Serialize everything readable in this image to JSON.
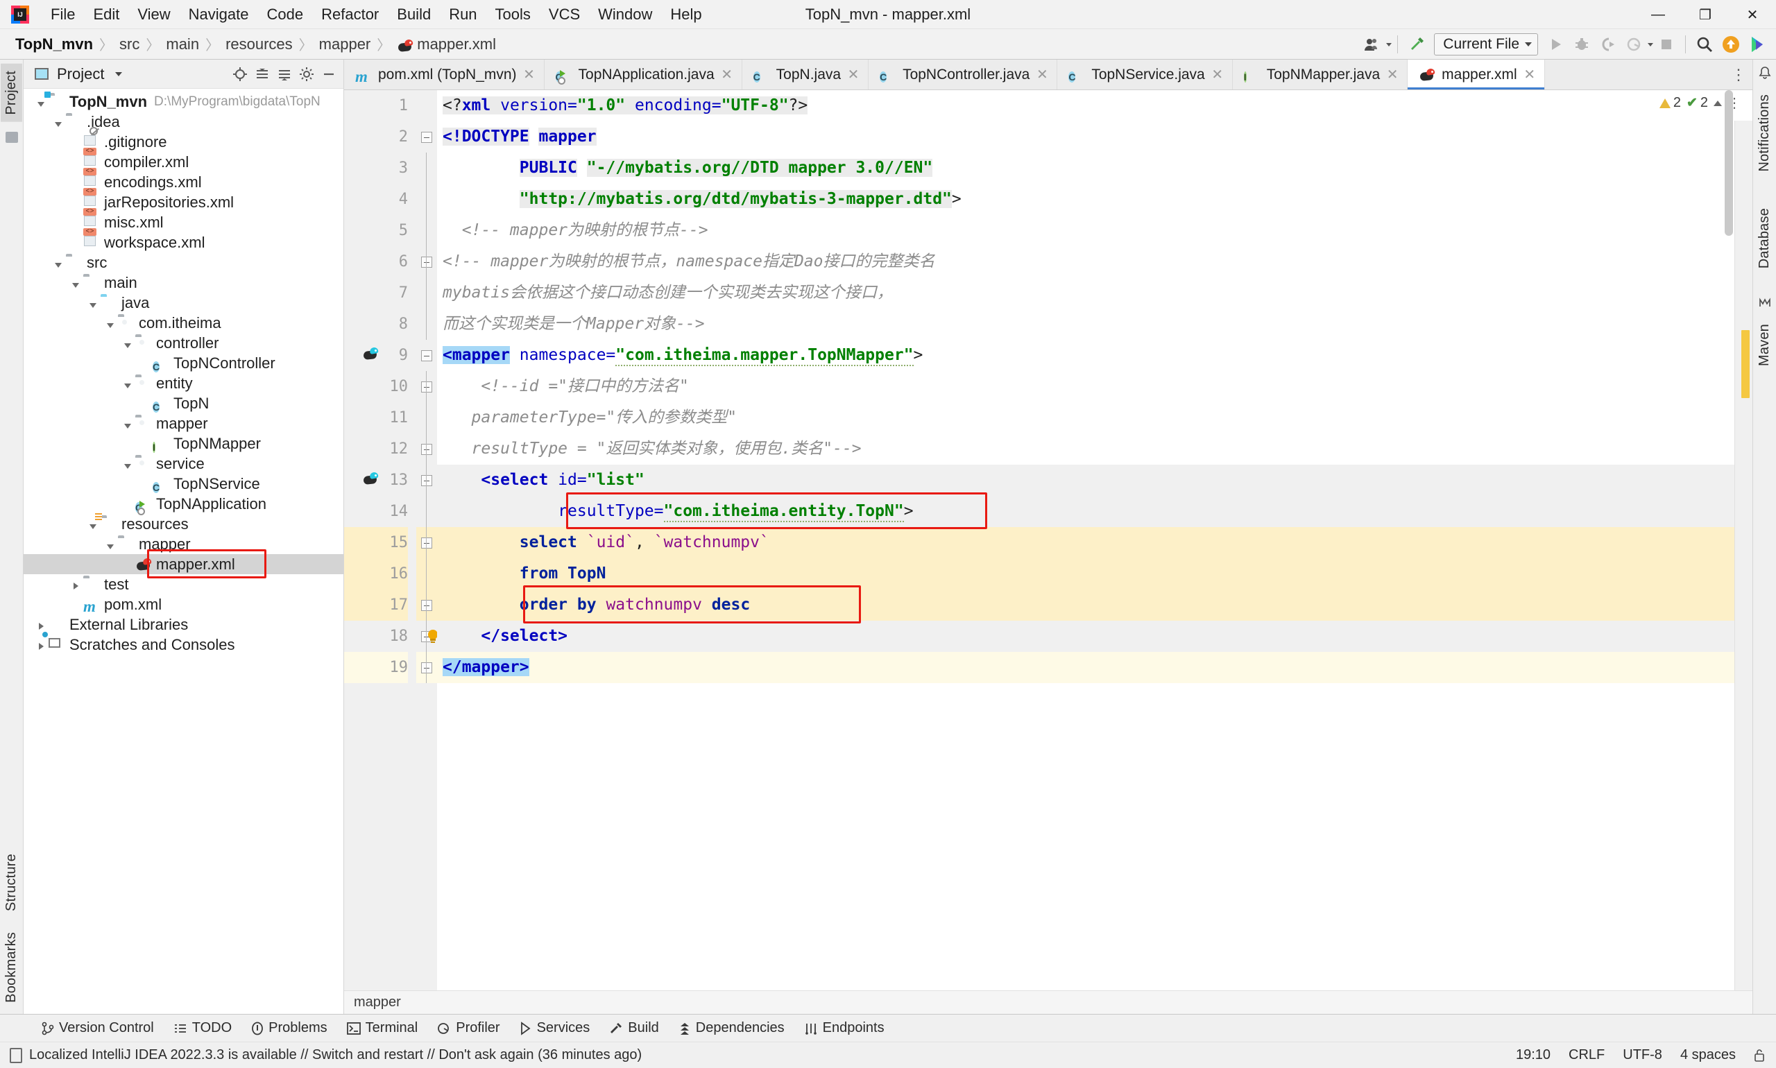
{
  "window": {
    "title": "TopN_mvn - mapper.xml",
    "minimize": "—",
    "maximize": "❐",
    "close": "✕"
  },
  "menubar": [
    {
      "label": "File"
    },
    {
      "label": "Edit"
    },
    {
      "label": "View"
    },
    {
      "label": "Navigate"
    },
    {
      "label": "Code"
    },
    {
      "label": "Refactor"
    },
    {
      "label": "Build"
    },
    {
      "label": "Run"
    },
    {
      "label": "Tools"
    },
    {
      "label": "VCS"
    },
    {
      "label": "Window"
    },
    {
      "label": "Help"
    }
  ],
  "breadcrumb": {
    "items": [
      "TopN_mvn",
      "src",
      "main",
      "resources",
      "mapper",
      "mapper.xml"
    ],
    "separator": "〉"
  },
  "toolbar": {
    "run_config": "Current File",
    "icons": [
      "account-icon",
      "build-hammer-icon",
      "run-icon",
      "debug-icon",
      "run-coverage-icon",
      "profile-icon",
      "stop-icon",
      "search-everywhere-icon",
      "update-icon",
      "ide-feature-icon"
    ]
  },
  "left_rail": {
    "project_tab": "Project",
    "structure_tab": "Structure",
    "bookmarks_tab": "Bookmarks"
  },
  "right_rail": {
    "notifications_tab": "Notifications",
    "database_tab": "Database",
    "maven_tab": "Maven"
  },
  "project_panel": {
    "title": "Project",
    "root": {
      "label": "TopN_mvn",
      "path": "D:\\MyProgram\\bigdata\\TopN"
    },
    "tree": [
      {
        "depth": 0,
        "label": "TopN_mvn",
        "path": "D:\\MyProgram\\bigdata\\TopN",
        "icon": "module-folder-icon",
        "arrow": "down",
        "bold": true
      },
      {
        "depth": 1,
        "label": ".idea",
        "icon": "folder-icon",
        "arrow": "down"
      },
      {
        "depth": 2,
        "label": ".gitignore",
        "icon": "gitignore-file-icon",
        "arrow": "none"
      },
      {
        "depth": 2,
        "label": "compiler.xml",
        "icon": "xml-file-icon",
        "arrow": "none"
      },
      {
        "depth": 2,
        "label": "encodings.xml",
        "icon": "xml-file-icon",
        "arrow": "none"
      },
      {
        "depth": 2,
        "label": "jarRepositories.xml",
        "icon": "xml-file-icon",
        "arrow": "none"
      },
      {
        "depth": 2,
        "label": "misc.xml",
        "icon": "xml-file-icon",
        "arrow": "none"
      },
      {
        "depth": 2,
        "label": "workspace.xml",
        "icon": "xml-file-icon",
        "arrow": "none"
      },
      {
        "depth": 1,
        "label": "src",
        "icon": "folder-icon",
        "arrow": "down"
      },
      {
        "depth": 2,
        "label": "main",
        "icon": "folder-icon",
        "arrow": "down"
      },
      {
        "depth": 3,
        "label": "java",
        "icon": "source-folder-icon",
        "arrow": "down"
      },
      {
        "depth": 4,
        "label": "com.itheima",
        "icon": "package-icon",
        "arrow": "down"
      },
      {
        "depth": 5,
        "label": "controller",
        "icon": "package-icon",
        "arrow": "down"
      },
      {
        "depth": 6,
        "label": "TopNController",
        "icon": "java-class-icon",
        "arrow": "none"
      },
      {
        "depth": 5,
        "label": "entity",
        "icon": "package-icon",
        "arrow": "down"
      },
      {
        "depth": 6,
        "label": "TopN",
        "icon": "java-class-icon",
        "arrow": "none"
      },
      {
        "depth": 5,
        "label": "mapper",
        "icon": "package-icon",
        "arrow": "down"
      },
      {
        "depth": 6,
        "label": "TopNMapper",
        "icon": "java-interface-icon",
        "arrow": "none"
      },
      {
        "depth": 5,
        "label": "service",
        "icon": "package-icon",
        "arrow": "down"
      },
      {
        "depth": 6,
        "label": "TopNService",
        "icon": "java-class-icon",
        "arrow": "none"
      },
      {
        "depth": 5,
        "label": "TopNApplication",
        "icon": "spring-boot-class-icon",
        "arrow": "none"
      },
      {
        "depth": 3,
        "label": "resources",
        "icon": "resources-folder-icon",
        "arrow": "down"
      },
      {
        "depth": 4,
        "label": "mapper",
        "icon": "folder-icon",
        "arrow": "down"
      },
      {
        "depth": 5,
        "label": "mapper.xml",
        "icon": "mybatis-file-icon",
        "arrow": "none",
        "selected": true,
        "highlighted": true
      },
      {
        "depth": 2,
        "label": "test",
        "icon": "folder-icon",
        "arrow": "right"
      },
      {
        "depth": 2,
        "label": "pom.xml",
        "icon": "maven-file-icon",
        "arrow": "none"
      },
      {
        "depth": 0,
        "label": "External Libraries",
        "icon": "external-libraries-icon",
        "arrow": "right"
      },
      {
        "depth": 0,
        "label": "Scratches and Consoles",
        "icon": "scratches-icon",
        "arrow": "right"
      }
    ]
  },
  "editor": {
    "tabs": [
      {
        "label": "pom.xml (TopN_mvn)",
        "icon": "maven-file-icon",
        "active": false
      },
      {
        "label": "TopNApplication.java",
        "icon": "spring-boot-class-icon",
        "active": false
      },
      {
        "label": "TopN.java",
        "icon": "java-class-icon",
        "active": false
      },
      {
        "label": "TopNController.java",
        "icon": "java-class-icon",
        "active": false
      },
      {
        "label": "TopNService.java",
        "icon": "java-class-icon",
        "active": false
      },
      {
        "label": "TopNMapper.java",
        "icon": "java-interface-icon",
        "active": false
      },
      {
        "label": "mapper.xml",
        "icon": "mybatis-file-icon",
        "active": true
      }
    ],
    "tab_close": "✕",
    "tabs_more": "⋮",
    "inspections": {
      "warnings": "2",
      "checks": "2",
      "warning_icon": "warning-triangle-icon",
      "check_icon": "inspection-check-icon"
    },
    "line_numbers": [
      "1",
      "2",
      "3",
      "4",
      "5",
      "6",
      "7",
      "8",
      "9",
      "10",
      "11",
      "12",
      "13",
      "14",
      "15",
      "16",
      "17",
      "18",
      "19"
    ],
    "lines": [
      {
        "n": 1,
        "tokens": [
          {
            "t": "<?",
            "c": "punc",
            "bg": "gray"
          },
          {
            "t": "xml",
            "c": "tag",
            "bg": "gray"
          },
          {
            "t": " version=",
            "c": "attr",
            "bg": "gray"
          },
          {
            "t": "\"1.0\"",
            "c": "str",
            "bg": "gray"
          },
          {
            "t": " encoding=",
            "c": "attr",
            "bg": "gray"
          },
          {
            "t": "\"UTF-8\"",
            "c": "str",
            "bg": "gray"
          },
          {
            "t": "?>",
            "c": "punc",
            "bg": "gray"
          }
        ]
      },
      {
        "n": 2,
        "tokens": [
          {
            "t": "<!DOCTYPE",
            "c": "tag",
            "bg": "gray"
          },
          {
            "t": " ",
            "c": "plain",
            "bg": "none"
          },
          {
            "t": "mapper",
            "c": "tag",
            "bg": "gray"
          }
        ]
      },
      {
        "n": 3,
        "tokens": [
          {
            "t": "        ",
            "c": "plain",
            "bg": "none"
          },
          {
            "t": "PUBLIC",
            "c": "tag",
            "bg": "gray"
          },
          {
            "t": " ",
            "c": "plain",
            "bg": "none"
          },
          {
            "t": "\"-//mybatis.org//DTD mapper 3.0//EN\"",
            "c": "str",
            "bg": "gray"
          }
        ]
      },
      {
        "n": 4,
        "tokens": [
          {
            "t": "        ",
            "c": "plain",
            "bg": "none"
          },
          {
            "t": "\"http://mybatis.org/dtd/mybatis-3-mapper.dtd\"",
            "c": "str",
            "bg": "gray"
          },
          {
            "t": ">",
            "c": "punc",
            "bg": "none"
          }
        ]
      },
      {
        "n": 5,
        "tokens": [
          {
            "t": "  <!-- mapper为映射的根节点-->",
            "c": "com",
            "bg": "none"
          }
        ]
      },
      {
        "n": 6,
        "tokens": [
          {
            "t": "<!-- mapper为映射的根节点，namespace指定Dao接口的完整类名",
            "c": "com",
            "bg": "none"
          }
        ]
      },
      {
        "n": 7,
        "tokens": [
          {
            "t": "mybatis会依据这个接口动态创建一个实现类去实现这个接口，",
            "c": "com",
            "bg": "none"
          }
        ]
      },
      {
        "n": 8,
        "tokens": [
          {
            "t": "而这个实现类是一个Mapper对象-->",
            "c": "com",
            "bg": "none"
          }
        ]
      },
      {
        "n": 9,
        "tokens": [
          {
            "t": "<mapper",
            "c": "tag",
            "bg": "sel"
          },
          {
            "t": " ",
            "c": "plain",
            "bg": "none"
          },
          {
            "t": "namespace=",
            "c": "attr",
            "bg": "none"
          },
          {
            "t": "\"com.itheima.mapper.TopNMapper\"",
            "c": "str",
            "bg": "none",
            "squiggle": true
          },
          {
            "t": ">",
            "c": "punc",
            "bg": "none"
          }
        ]
      },
      {
        "n": 10,
        "tokens": [
          {
            "t": "    <!--id =\"接口中的方法名\"",
            "c": "com",
            "bg": "none"
          }
        ]
      },
      {
        "n": 11,
        "tokens": [
          {
            "t": "   parameterType=\"传入的参数类型\"",
            "c": "com",
            "bg": "none"
          }
        ]
      },
      {
        "n": 12,
        "tokens": [
          {
            "t": "   resultType = \"返回实体类对象，使用包.类名\"-->",
            "c": "com",
            "bg": "none"
          }
        ]
      },
      {
        "n": 13,
        "bg": "lgray",
        "tokens": [
          {
            "t": "    ",
            "c": "plain",
            "bg": "none"
          },
          {
            "t": "<select",
            "c": "tag",
            "bg": "white"
          },
          {
            "t": " ",
            "c": "plain",
            "bg": "white"
          },
          {
            "t": "id=",
            "c": "attr",
            "bg": "white"
          },
          {
            "t": "\"list\"",
            "c": "str",
            "bg": "white"
          }
        ]
      },
      {
        "n": 14,
        "bg": "lgray",
        "boxed": "resultType",
        "tokens": [
          {
            "t": "            ",
            "c": "plain",
            "bg": "none"
          },
          {
            "t": "resultType=",
            "c": "attr",
            "bg": "none"
          },
          {
            "t": "\"com.itheima.entity.TopN\"",
            "c": "str",
            "bg": "none",
            "squiggle": true
          },
          {
            "t": ">",
            "c": "punc",
            "bg": "none"
          }
        ]
      },
      {
        "n": 15,
        "bg": "yellow",
        "tokens": [
          {
            "t": "        ",
            "c": "plain",
            "bg": "none"
          },
          {
            "t": "select",
            "c": "sql",
            "bg": "none"
          },
          {
            "t": " ",
            "c": "plain",
            "bg": "none"
          },
          {
            "t": "`uid`",
            "c": "col",
            "bg": "none"
          },
          {
            "t": ", ",
            "c": "plain",
            "bg": "none"
          },
          {
            "t": "`watchnumpv`",
            "c": "col",
            "bg": "none"
          }
        ]
      },
      {
        "n": 16,
        "bg": "yellow",
        "tokens": [
          {
            "t": "        ",
            "c": "plain",
            "bg": "none"
          },
          {
            "t": "from",
            "c": "sql",
            "bg": "none"
          },
          {
            "t": " ",
            "c": "plain",
            "bg": "none"
          },
          {
            "t": "TopN",
            "c": "sqlplain",
            "bg": "none"
          }
        ]
      },
      {
        "n": 17,
        "bg": "yellow",
        "boxed": "orderby",
        "tokens": [
          {
            "t": "        ",
            "c": "plain",
            "bg": "none"
          },
          {
            "t": "order",
            "c": "sql",
            "bg": "none"
          },
          {
            "t": " ",
            "c": "plain",
            "bg": "none"
          },
          {
            "t": "by",
            "c": "sql",
            "bg": "none"
          },
          {
            "t": " ",
            "c": "plain",
            "bg": "none"
          },
          {
            "t": "watchnumpv",
            "c": "col",
            "bg": "none"
          },
          {
            "t": " ",
            "c": "plain",
            "bg": "none"
          },
          {
            "t": "desc",
            "c": "sql",
            "bg": "none"
          }
        ]
      },
      {
        "n": 18,
        "bg": "lgray",
        "bulb": true,
        "tokens": [
          {
            "t": "    ",
            "c": "plain",
            "bg": "none"
          },
          {
            "t": "</select>",
            "c": "tag",
            "bg": "white"
          }
        ]
      },
      {
        "n": 19,
        "bg": "cream",
        "tokens": [
          {
            "t": "</mapper>",
            "c": "tag",
            "bg": "sel"
          }
        ]
      }
    ],
    "breadcrumb_bottom": "mapper"
  },
  "tool_windows": [
    {
      "label": "Version Control",
      "icon": "branch-icon"
    },
    {
      "label": "TODO",
      "icon": "todo-list-icon"
    },
    {
      "label": "Problems",
      "icon": "problems-icon"
    },
    {
      "label": "Terminal",
      "icon": "terminal-icon"
    },
    {
      "label": "Profiler",
      "icon": "profiler-icon"
    },
    {
      "label": "Services",
      "icon": "services-icon"
    },
    {
      "label": "Build",
      "icon": "build-hammer-icon"
    },
    {
      "label": "Dependencies",
      "icon": "dependencies-icon"
    },
    {
      "label": "Endpoints",
      "icon": "endpoints-icon"
    }
  ],
  "statusbar": {
    "message": "Localized IntelliJ IDEA 2022.3.3 is available // Switch and restart // Don't ask again (36 minutes ago)",
    "message_icon": "notification-icon",
    "caret": "19:10",
    "line_sep": "CRLF",
    "encoding": "UTF-8",
    "indent": "4 spaces",
    "lock_icon": "unlocked-icon"
  },
  "colors": {
    "accent_blue": "#3f7fd0",
    "annotation_red": "#e81a12",
    "tag_blue": "#0000c0",
    "string_green": "#008000",
    "comment_gray": "#8c8c8c",
    "sql_navy": "#00219c",
    "column_purple": "#8b0f8b",
    "highlight_yellow": "#fdf0c8",
    "selection_blue": "#a6d8f7"
  }
}
